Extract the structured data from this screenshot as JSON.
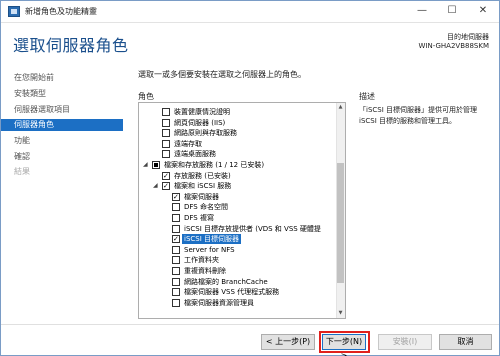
{
  "window": {
    "title": "新增角色及功能精靈",
    "minimize_glyph": "—",
    "maximize_glyph": "☐",
    "close_glyph": "✕"
  },
  "header": {
    "title": "選取伺服器角色",
    "server_label": "目的地伺服器",
    "server_name": "WIN-GHA2VB88SKM"
  },
  "nav": {
    "items": [
      {
        "label": "在您開始前",
        "state": "normal"
      },
      {
        "label": "安裝類型",
        "state": "normal"
      },
      {
        "label": "伺服器選取項目",
        "state": "normal"
      },
      {
        "label": "伺服器角色",
        "state": "active"
      },
      {
        "label": "功能",
        "state": "normal"
      },
      {
        "label": "確認",
        "state": "normal"
      },
      {
        "label": "結果",
        "state": "disabled"
      }
    ]
  },
  "main": {
    "instruction": "選取一或多個要安裝在選取之伺服器上的角色。",
    "roles_label": "角色",
    "description_label": "描述",
    "description_text": "「iSCSI 目標伺服器」提供可用於管理 iSCSI 目標的服務和管理工具。"
  },
  "roles": [
    {
      "label": "裝置健康情況證明",
      "check": "none",
      "arrow": ""
    },
    {
      "label": "網頁伺服器 (IIS)",
      "check": "none",
      "arrow": ""
    },
    {
      "label": "網路原則與存取服務",
      "check": "none",
      "arrow": ""
    },
    {
      "label": "遠端存取",
      "check": "none",
      "arrow": ""
    },
    {
      "label": "遠端桌面服務",
      "check": "none",
      "arrow": ""
    },
    {
      "label": "檔案和存放服務 (1 / 12 已安裝)",
      "check": "partial",
      "arrow": "◢"
    },
    {
      "label": "存放服務 (已安裝)",
      "check": "checked",
      "arrow": ""
    },
    {
      "label": "檔案和 iSCSI 服務",
      "check": "checked",
      "arrow": "◢"
    },
    {
      "label": "檔案伺服器",
      "check": "checked",
      "arrow": ""
    },
    {
      "label": "DFS 命名空間",
      "check": "none",
      "arrow": ""
    },
    {
      "label": "DFS 複寫",
      "check": "none",
      "arrow": ""
    },
    {
      "label": "iSCSI 目標存放提供者 (VDS 和 VSS 硬體提",
      "check": "none",
      "arrow": ""
    },
    {
      "label": "iSCSI 目標伺服器",
      "check": "checked",
      "arrow": ""
    },
    {
      "label": "Server for NFS",
      "check": "none",
      "arrow": ""
    },
    {
      "label": "工作資料夾",
      "check": "none",
      "arrow": ""
    },
    {
      "label": "重複資料刪除",
      "check": "none",
      "arrow": ""
    },
    {
      "label": "網路檔案的 BranchCache",
      "check": "none",
      "arrow": ""
    },
    {
      "label": "檔案伺服器 VSS 代理程式服務",
      "check": "none",
      "arrow": ""
    },
    {
      "label": "檔案伺服器資源管理員",
      "check": "none",
      "arrow": ""
    }
  ],
  "footer": {
    "prev_label": "< 上一步(P)",
    "next_label": "下一步(N) >",
    "install_label": "安裝(I)",
    "cancel_label": "取消"
  },
  "colors": {
    "accent": "#1c6fc4",
    "title": "#1a4f8c",
    "highlight": "#e0201c"
  }
}
